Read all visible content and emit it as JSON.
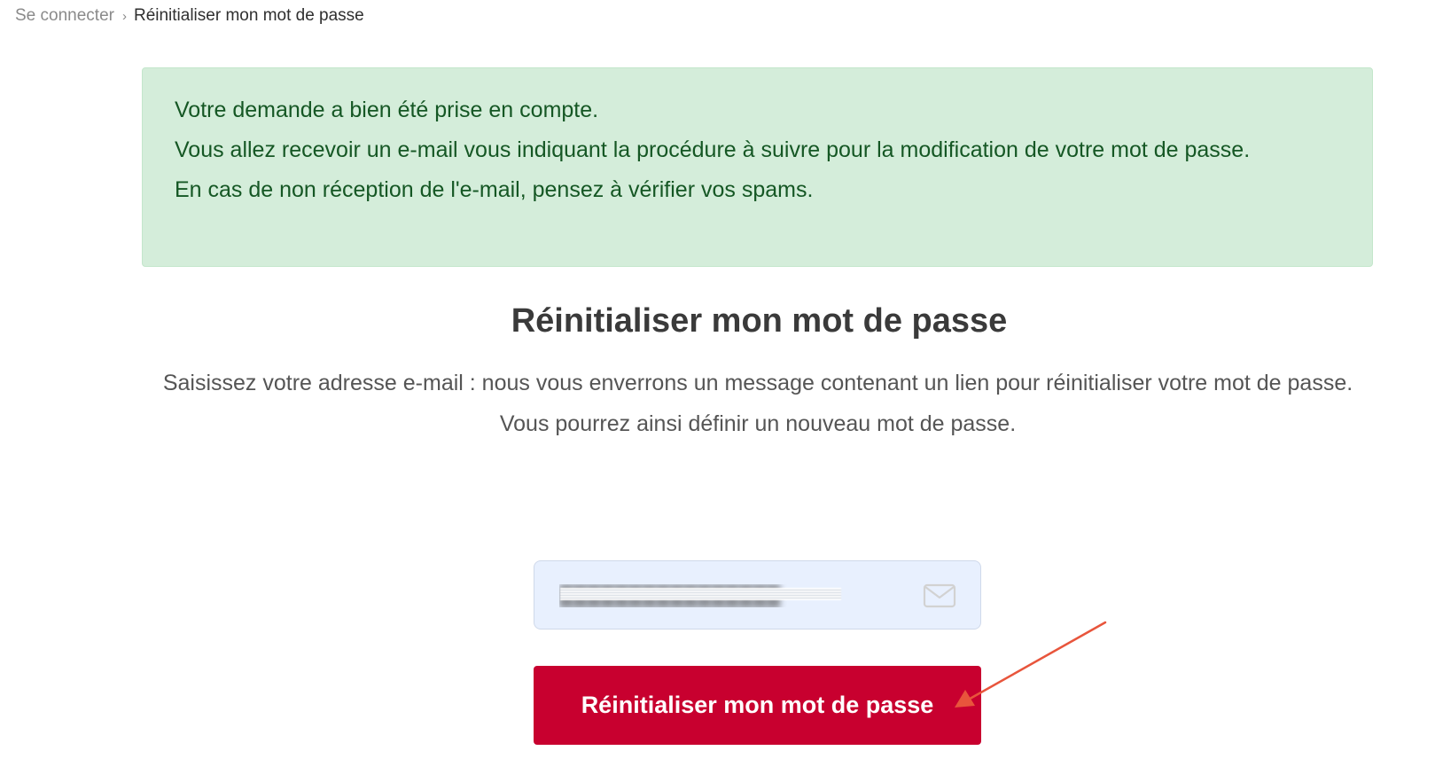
{
  "breadcrumb": {
    "parent": "Se connecter",
    "separator": "›",
    "current": "Réinitialiser mon mot de passe"
  },
  "alert": {
    "line1": "Votre demande a bien été prise en compte.",
    "line2": "Vous allez recevoir un e-mail vous indiquant la procédure à suivre pour la modification de votre mot de passe.",
    "line3": "En cas de non réception de l'e-mail, pensez à vérifier vos spams.",
    "background": "#d4edda",
    "text_color": "#155724"
  },
  "form": {
    "title": "Réinitialiser mon mot de passe",
    "description": "Saisissez votre adresse e-mail : nous vous enverrons un message contenant un lien pour réinitialiser votre mot de passe. Vous pourrez ainsi définir un nouveau mot de passe.",
    "email_value": "████████████████",
    "email_icon": "envelope-icon",
    "submit_label": "Réinitialiser mon mot de passe",
    "submit_color": "#c8002f"
  },
  "annotation": {
    "arrow_color": "#e8553c"
  }
}
